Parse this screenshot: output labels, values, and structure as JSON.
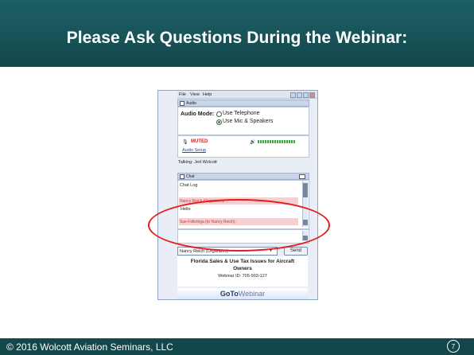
{
  "slide": {
    "title": "Please Ask Questions During the Webinar:",
    "footer": "© 2016 Wolcott Aviation Seminars, LLC",
    "page_number": "7"
  },
  "window": {
    "menu": [
      "File",
      "View",
      "Help"
    ],
    "audio": {
      "section_label": "Audio",
      "mode_label": "Audio Mode:",
      "options": [
        "Use Telephone",
        "Use Mic & Speakers"
      ],
      "selected_option": "Use Mic & Speakers",
      "mic_status": "MUTED",
      "setup_link": "Audio Setup",
      "talking": "Talking: Jed Wolcott"
    },
    "chat": {
      "section_label": "Chat",
      "log_label": "Chat Log",
      "messages": [
        "Nancy Reich (Organizer):",
        "Hello",
        "Sue Folkringa (to Nancy Reich):"
      ],
      "recipient": "Nancy Reich (Organizer)",
      "send_label": "Send"
    },
    "webinar": {
      "title_line1": "Florida Sales & Use Tax Issues for Aircraft",
      "title_line2": "Owners",
      "id_line": "Webinar ID: 705-903-127"
    },
    "brand": {
      "goto": "GoTo",
      "webinar": "Webinar"
    }
  },
  "colors": {
    "title_bar": "#1d6066",
    "footer_bar": "#13474b",
    "highlight_ellipse": "#e02020",
    "muted_red": "#d02020"
  }
}
